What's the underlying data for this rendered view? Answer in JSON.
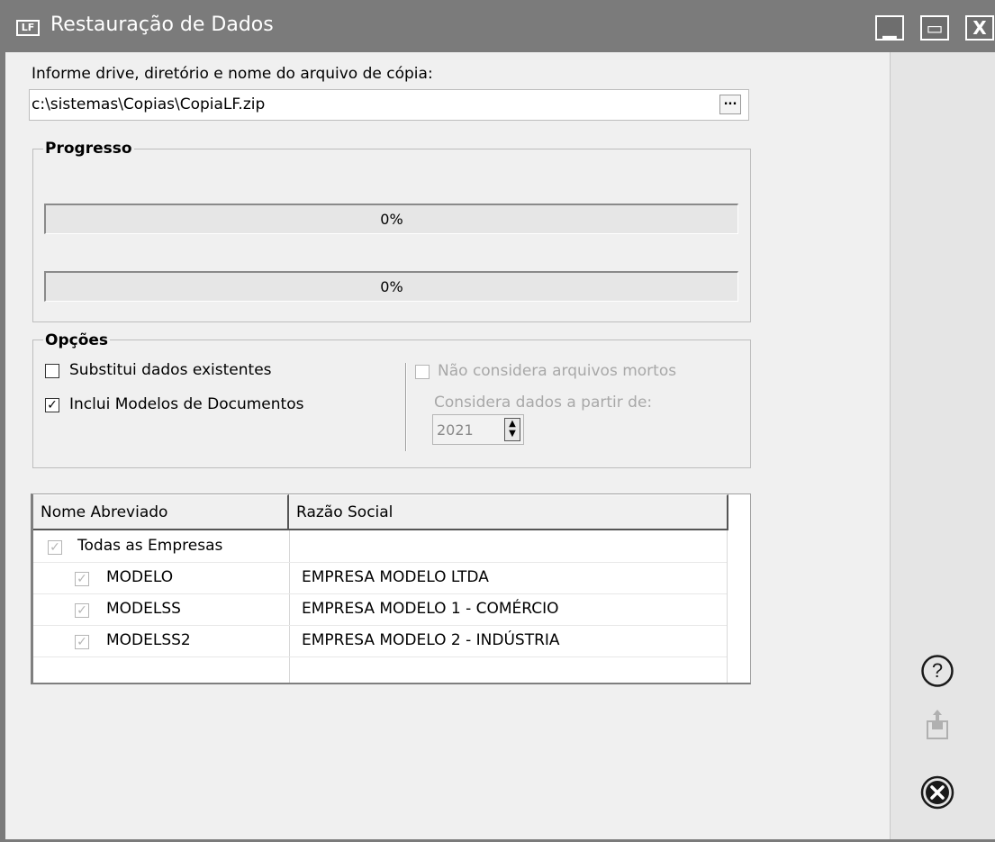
{
  "window": {
    "icon_text": "LF",
    "title": "Restauração de Dados",
    "minimize_glyph": "▁",
    "maximize_glyph": "▭",
    "close_glyph": "X"
  },
  "file": {
    "prompt": "Informe drive, diretório e nome do arquivo de cópia:",
    "value": "c:\\sistemas\\Copias\\CopiaLF.zip",
    "browse_label": "..."
  },
  "progress": {
    "legend": "Progresso",
    "bar1": {
      "label": "0%",
      "value": 0
    },
    "bar2": {
      "label": "0%",
      "value": 0
    }
  },
  "options": {
    "legend": "Opções",
    "substitui": {
      "label": "Substitui dados existentes",
      "checked": false
    },
    "modelos": {
      "label": "Inclui Modelos de Documentos",
      "checked": true
    },
    "arquivos_mortos": {
      "label": "Não considera arquivos mortos",
      "checked": false,
      "enabled": false
    },
    "considera_label": "Considera dados a partir de:",
    "year": "2021"
  },
  "grid": {
    "columns": [
      "Nome Abreviado",
      "Razão Social"
    ],
    "rows": [
      {
        "nome": "Todas as Empresas",
        "razao": "",
        "checked": true
      },
      {
        "nome": "MODELO",
        "razao": "EMPRESA MODELO LTDA",
        "checked": true
      },
      {
        "nome": "MODELSS",
        "razao": "EMPRESA MODELO 1 - COMÉRCIO",
        "checked": true
      },
      {
        "nome": "MODELSS2",
        "razao": "EMPRESA MODELO 2 - INDÚSTRIA",
        "checked": true
      }
    ]
  },
  "side_buttons": {
    "help_icon": "help-icon",
    "export_icon": "export-icon",
    "close_icon": "close-circle-icon"
  },
  "colors": {
    "titlebar": "#7b7b7b",
    "background": "#f0f0f0",
    "side_panel": "#e5e5e5"
  }
}
